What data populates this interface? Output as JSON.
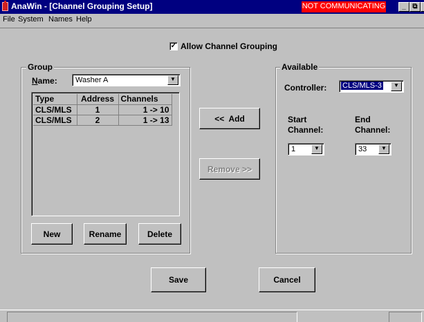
{
  "window": {
    "title": "AnaWin - [Channel Grouping Setup]"
  },
  "menu": {
    "items": [
      "File",
      "System",
      "Names",
      "Help"
    ]
  },
  "allow_grouping": {
    "label": "Allow Channel Grouping",
    "checked": true
  },
  "group": {
    "title": "Group",
    "name_label": "Name:",
    "name_value": "Washer A",
    "columns": [
      "Type",
      "Address",
      "Channels"
    ],
    "rows": [
      [
        "CLS/MLS",
        "1",
        "1 -> 10"
      ],
      [
        "CLS/MLS",
        "2",
        "1 -> 13"
      ]
    ],
    "new_label": "New",
    "rename_label": "Rename",
    "delete_label": "Delete"
  },
  "actions": {
    "add_label": "<<  Add",
    "remove_label": "Remove >>"
  },
  "available": {
    "title": "Available",
    "controller_label": "Controller:",
    "controller_value": "CLS/MLS-3",
    "start_label_1": "Start",
    "start_label_2": "Channel:",
    "start_value": "1",
    "end_label_1": "End",
    "end_label_2": "Channel:",
    "end_value": "33"
  },
  "footer": {
    "save_label": "Save",
    "cancel_label": "Cancel"
  },
  "status": {
    "comm_text": "NOT COMMUNICATING"
  }
}
